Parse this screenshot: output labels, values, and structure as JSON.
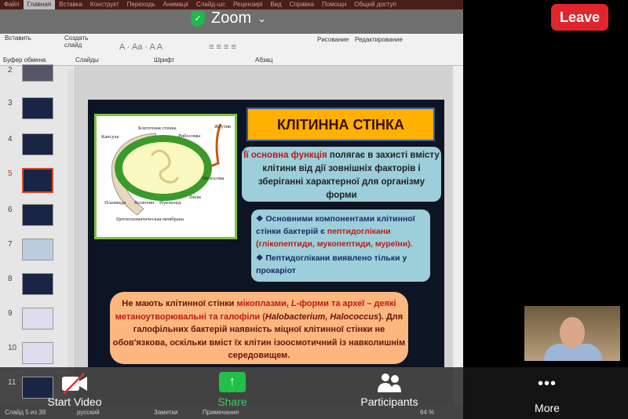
{
  "ribbon": {
    "tabs": [
      "Файл",
      "Главная",
      "Вставка",
      "Конструкт",
      "Переходь",
      "Анимаціі",
      "Слайд-шс",
      "Рецензирі",
      "Вид",
      "Справка",
      "Помощн",
      "Общий доступ"
    ],
    "paste": "Вставить",
    "new_slide": "Создать слайд",
    "drawing": "Рисование",
    "editing": "Редактирование",
    "groups": [
      "Буфер обмена",
      "Слайды",
      "Шрифт",
      "Абзац"
    ]
  },
  "zoom": {
    "title": "Zoom",
    "leave": "Leave",
    "start_video": "Start Video",
    "share": "Share",
    "participants": "Participants",
    "more": "More"
  },
  "thumbnails": [
    "2",
    "3",
    "4",
    "5",
    "6",
    "7",
    "8",
    "9",
    "10",
    "11"
  ],
  "slide": {
    "title": "КЛІТИННА СТІНКА",
    "diagram_labels": [
      "Капсула",
      "Клеточная стенка",
      "Рибосомы",
      "Жгутик",
      "Мезосома",
      "Пили",
      "Плазмида",
      "Волютин",
      "Нуклеоид",
      "Цитоплазматическая мембрана"
    ],
    "box1": {
      "highlight": "Її основна функція",
      "text": " полягає в захисті вмісту клітини від дії зовнішніх факторів і зберіганні характерної для організму форми"
    },
    "box2": {
      "b1a": "Основними компонентами клітинної стінки бактерій є ",
      "b1b": "пептидоглікани (глікопептиди, мукопептиди, муреїни).",
      "b2": "Пептидоглікани виявлено тільки у прокаріот"
    },
    "box3": {
      "t1": "Не мають клітинної стінки ",
      "t2": "мікоплазми, ",
      "t3": "L",
      "t4": "-форми та археї – деякі метаноутворювальні та галофіли (",
      "t5": "Halobacterium, Halococcus",
      "t6": "). Для галофільних бактерій наявність міцної клітинної стінки не  обов'язкова, оскільки вміст їх клітин ізоосмотичний із навколишнім середовищем."
    }
  },
  "status": {
    "slide": "Слайд 5 из 38",
    "lang": "русский",
    "notes": "Заметки",
    "comments": "Примечания",
    "zoom": "64 %"
  },
  "selected_slide": "5"
}
